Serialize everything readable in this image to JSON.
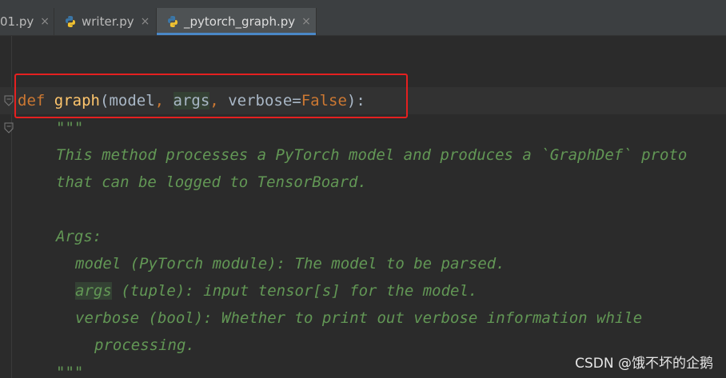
{
  "tabs": [
    {
      "label": "01.py",
      "active": false
    },
    {
      "label": "writer.py",
      "active": false
    },
    {
      "label": "_pytorch_graph.py",
      "active": true
    }
  ],
  "tab_close_glyph": "×",
  "code": {
    "signature": {
      "def": "def",
      "name": "graph",
      "open": "(",
      "p1": "model",
      "comma1": ", ",
      "p2": "args",
      "comma2": ", ",
      "p3": "verbose",
      "eq": "=",
      "default": "False",
      "close": "):"
    },
    "doc_open": "\"\"\"",
    "doc_line1": "This method processes a PyTorch model and produces a `GraphDef` proto",
    "doc_line2": "that can be logged to TensorBoard.",
    "doc_args": "Args:",
    "doc_model": "model (PyTorch module): The model to be parsed.",
    "doc_args_name": "args",
    "doc_args_rest": " (tuple): input tensor[s] for the model.",
    "doc_verbose": "verbose (bool): Whether to print out verbose information while",
    "doc_processing": "processing.",
    "doc_close": "\"\"\""
  },
  "colors": {
    "keyword": "#cc7832",
    "function": "#ffc66d",
    "docstring": "#629755",
    "highlight_box": "#e52020",
    "tab_underline": "#4a88c7"
  },
  "watermark": "CSDN @饿不坏的企鹅"
}
